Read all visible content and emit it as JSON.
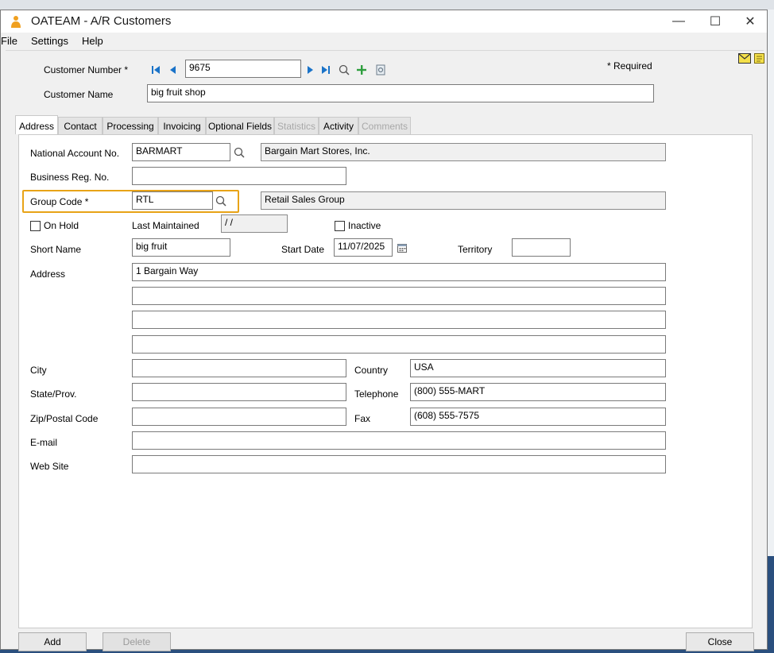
{
  "window": {
    "title": "OATEAM - A/R Customers",
    "minimize": "—",
    "maximize": "☐",
    "close": "✕"
  },
  "menu": [
    "File",
    "Settings",
    "Help"
  ],
  "header": {
    "customer_number_label": "Customer Number *",
    "customer_number_value": "9675",
    "customer_name_label": "Customer Name",
    "customer_name_value": "big fruit shop",
    "required_note": "* Required"
  },
  "tabs": [
    {
      "label": "Address",
      "state": "active"
    },
    {
      "label": "Contact",
      "state": "normal"
    },
    {
      "label": "Processing",
      "state": "normal"
    },
    {
      "label": "Invoicing",
      "state": "normal"
    },
    {
      "label": "Optional Fields",
      "state": "normal"
    },
    {
      "label": "Statistics",
      "state": "disabled"
    },
    {
      "label": "Activity",
      "state": "normal"
    },
    {
      "label": "Comments",
      "state": "disabled"
    }
  ],
  "address": {
    "national_account_label": "National Account No.",
    "national_account_value": "BARMART",
    "national_account_desc": "Bargain Mart Stores, Inc.",
    "business_reg_label": "Business Reg. No.",
    "business_reg_value": "",
    "group_code_label": "Group Code *",
    "group_code_value": "RTL",
    "group_code_desc": "Retail Sales Group",
    "on_hold_label": "On Hold",
    "last_maintained_label": "Last Maintained",
    "last_maintained_value": "/ /",
    "inactive_label": "Inactive",
    "short_name_label": "Short Name",
    "short_name_value": "big fruit",
    "start_date_label": "Start Date",
    "start_date_value": "11/07/2025",
    "territory_label": "Territory",
    "territory_value": "",
    "address_label": "Address",
    "address_lines": [
      "1 Bargain Way",
      "",
      "",
      ""
    ],
    "city_label": "City",
    "city_value": "",
    "country_label": "Country",
    "country_value": "USA",
    "state_label": "State/Prov.",
    "state_value": "",
    "telephone_label": "Telephone",
    "telephone_value": "(800) 555-MART",
    "zip_label": "Zip/Postal Code",
    "zip_value": "",
    "fax_label": "Fax",
    "fax_value": "(608) 555-7575",
    "email_label": "E-mail",
    "email_value": "",
    "website_label": "Web Site",
    "website_value": ""
  },
  "footer": {
    "add_label": "Add",
    "delete_label": "Delete",
    "close_label": "Close"
  },
  "colors": {
    "highlight": "#e8a317",
    "nav_arrow": "#1a73c8",
    "add_plus": "#2e9e3e"
  }
}
